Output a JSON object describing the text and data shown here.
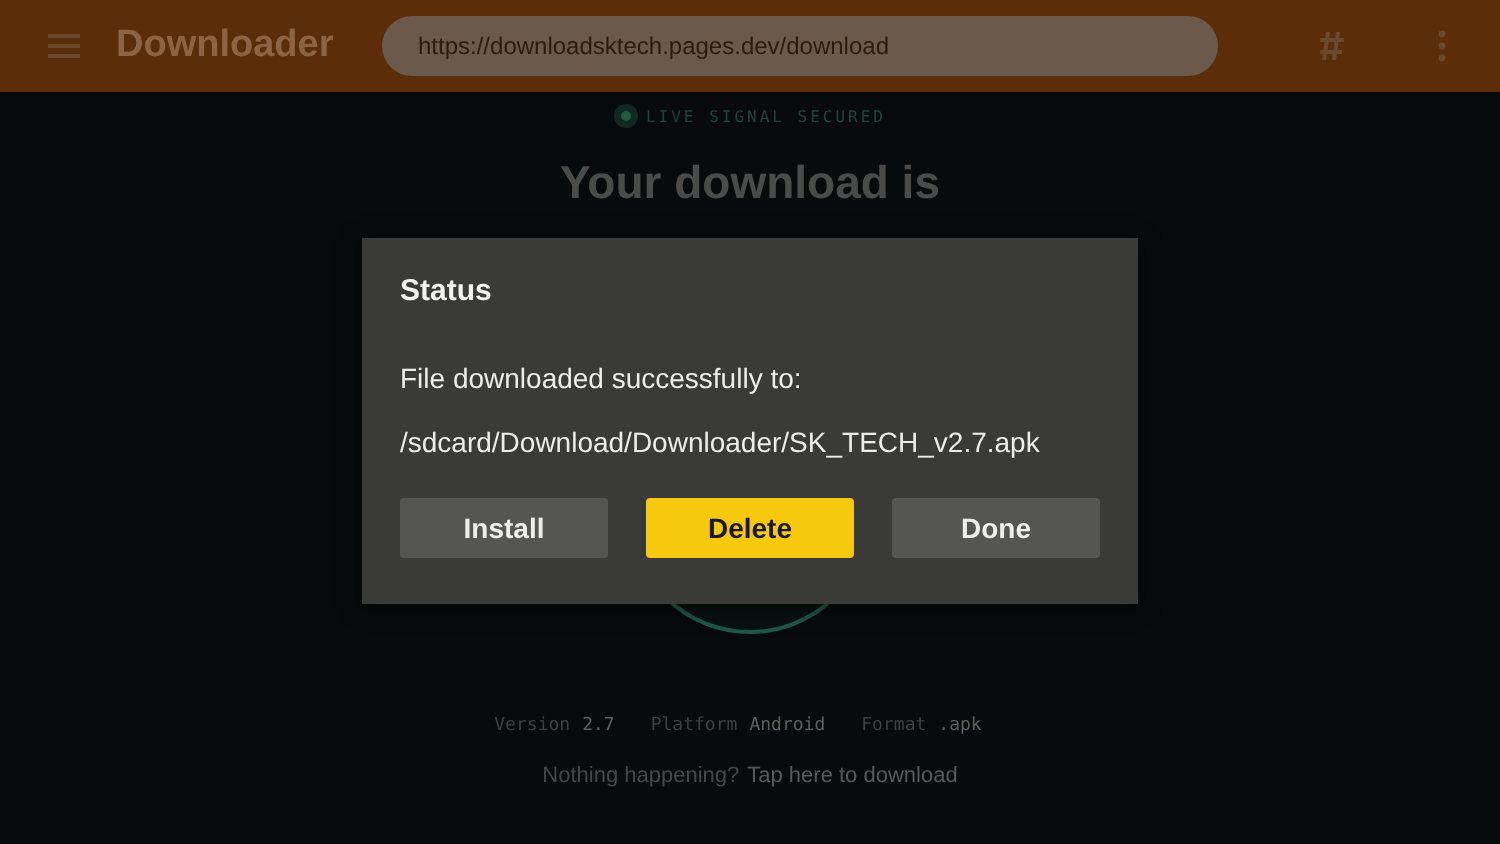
{
  "app_bar": {
    "title": "Downloader",
    "url": "https://downloadsktech.pages.dev/download"
  },
  "page": {
    "badge": "LIVE SIGNAL SECURED",
    "heading": "Your download is",
    "meta": [
      {
        "label": "Version",
        "value": "2.7"
      },
      {
        "label": "Platform",
        "value": "Android"
      },
      {
        "label": "Format",
        "value": ".apk"
      }
    ],
    "help_text": "Nothing happening?",
    "help_link": "Tap here to download"
  },
  "dialog": {
    "title": "Status",
    "message": "File downloaded successfully to:",
    "path": "/sdcard/Download/Downloader/SK_TECH_v2.7.apk",
    "buttons": [
      {
        "label": "Install",
        "selected": false
      },
      {
        "label": "Delete",
        "selected": true
      },
      {
        "label": "Done",
        "selected": false
      }
    ]
  }
}
